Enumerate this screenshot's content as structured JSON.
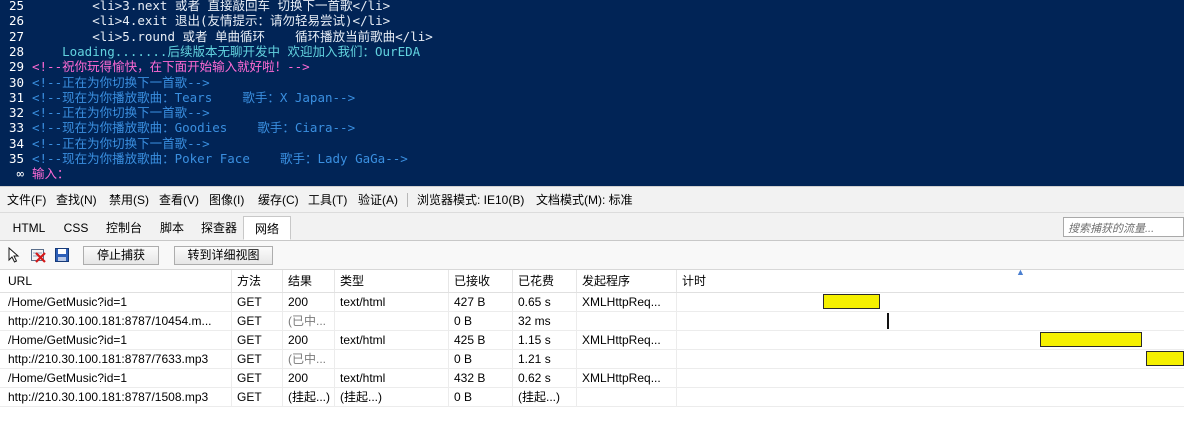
{
  "console": {
    "lines": [
      {
        "num": "25",
        "text": "        <li>3.next 或者 直接敲回车 切换下一首歌</li>",
        "color": "white"
      },
      {
        "num": "26",
        "text": "        <li>4.exit 退出(友情提示：请勿轻易尝试)</li>",
        "color": "white"
      },
      {
        "num": "27",
        "text": "        <li>5.round 或者 单曲循环    循环播放当前歌曲</li>",
        "color": "white"
      },
      {
        "num": "28",
        "text": "    Loading.......后续版本无聊开发中 欢迎加入我们：OurEDA",
        "color": "cyan"
      },
      {
        "num": "29",
        "text": "<!--祝你玩得愉快，在下面开始输入就好啦！-->",
        "color": "pink"
      },
      {
        "num": "30",
        "text": "<!--正在为你切换下一首歌-->",
        "color": "blue"
      },
      {
        "num": "31",
        "text": "<!--现在为你播放歌曲：Tears    歌手：X Japan-->",
        "color": "blue"
      },
      {
        "num": "32",
        "text": "<!--正在为你切换下一首歌-->",
        "color": "blue"
      },
      {
        "num": "33",
        "text": "<!--现在为你播放歌曲：Goodies    歌手：Ciara-->",
        "color": "blue"
      },
      {
        "num": "34",
        "text": "<!--正在为你切换下一首歌-->",
        "color": "blue"
      },
      {
        "num": "35",
        "text": "<!--现在为你播放歌曲：Poker Face    歌手：Lady GaGa-->",
        "color": "blue"
      },
      {
        "num": "∞",
        "text": "输入：",
        "color": "pink"
      }
    ]
  },
  "menu": {
    "items": [
      "文件(F)",
      "查找(N)",
      "禁用(S)",
      "查看(V)",
      "图像(I)",
      "缓存(C)",
      "工具(T)",
      "验证(A)"
    ],
    "browser_mode": "浏览器模式: IE10(B)",
    "document_mode": "文档模式(M): 标准"
  },
  "tabs": {
    "items": [
      "HTML",
      "CSS",
      "控制台",
      "脚本",
      "探查器",
      "网络"
    ],
    "active": "网络",
    "search_placeholder": "搜索捕获的流量..."
  },
  "toolbar": {
    "stop_capture": "停止捕获",
    "detail_view": "转到详细视图"
  },
  "network": {
    "columns": [
      "URL",
      "方法",
      "结果",
      "类型",
      "已接收",
      "已花费",
      "发起程序",
      "计时"
    ],
    "rows": [
      {
        "url": "/Home/GetMusic?id=1",
        "method": "GET",
        "result": "200",
        "type": "text/html",
        "received": "427 B",
        "taken": "0.65 s",
        "initiator": "XMLHttpReq...",
        "timing": {
          "start": 0.287,
          "length": 0.113,
          "kind": "bar"
        }
      },
      {
        "url": "http://210.30.100.181:8787/10454.m...",
        "method": "GET",
        "result": "(已中...",
        "type": "",
        "received": "0 B",
        "taken": "32 ms",
        "initiator": "",
        "timing": {
          "start": 0.414,
          "length": 0.004,
          "kind": "line"
        }
      },
      {
        "url": "/Home/GetMusic?id=1",
        "method": "GET",
        "result": "200",
        "type": "text/html",
        "received": "425 B",
        "taken": "1.15 s",
        "initiator": "XMLHttpReq...",
        "timing": {
          "start": 0.715,
          "length": 0.203,
          "kind": "bar"
        }
      },
      {
        "url": "http://210.30.100.181:8787/7633.mp3",
        "method": "GET",
        "result": "(已中...",
        "type": "",
        "received": "0 B",
        "taken": "1.21 s",
        "initiator": "",
        "timing": {
          "start": 0.925,
          "length": 0.075,
          "kind": "bar"
        }
      },
      {
        "url": "/Home/GetMusic?id=1",
        "method": "GET",
        "result": "200",
        "type": "text/html",
        "received": "432 B",
        "taken": "0.62 s",
        "initiator": "XMLHttpReq...",
        "timing": null
      },
      {
        "url": "http://210.30.100.181:8787/1508.mp3",
        "method": "GET",
        "result": "(挂起...)",
        "type": "(挂起...)",
        "received": "0 B",
        "taken": "(挂起...)",
        "initiator": "",
        "timing": null
      }
    ]
  },
  "colors": {
    "console_bg": "#012456",
    "timing_bar": "#f5f000"
  }
}
